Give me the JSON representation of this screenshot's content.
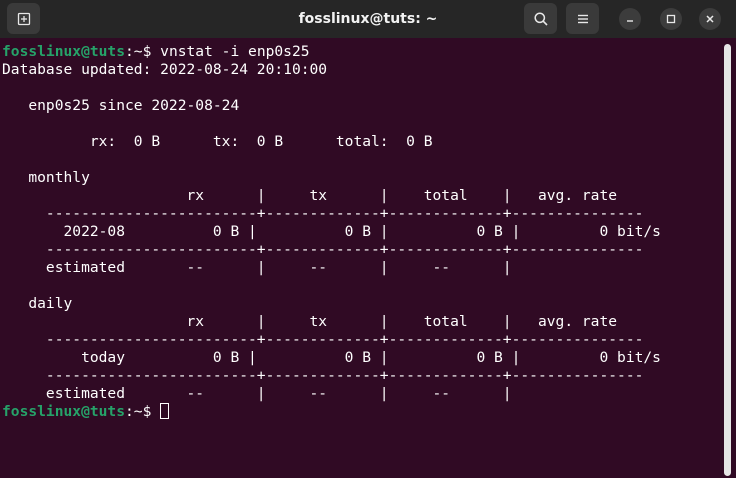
{
  "window": {
    "title": "fosslinux@tuts: ~"
  },
  "terminal": {
    "lines": [
      {
        "type": "prompt",
        "user": "fosslinux@tuts",
        "path": ":~",
        "cmd": "$ vnstat -i enp0s25"
      },
      {
        "type": "text",
        "text": "Database updated: 2022-08-24 20:10:00"
      },
      {
        "type": "text",
        "text": ""
      },
      {
        "type": "text",
        "text": "   enp0s25 since 2022-08-24"
      },
      {
        "type": "text",
        "text": ""
      },
      {
        "type": "text",
        "text": "          rx:  0 B      tx:  0 B      total:  0 B"
      },
      {
        "type": "text",
        "text": ""
      },
      {
        "type": "text",
        "text": "   monthly"
      },
      {
        "type": "text",
        "text": "                     rx      |     tx      |    total    |   avg. rate"
      },
      {
        "type": "text",
        "text": "     ------------------------+-------------+-------------+---------------"
      },
      {
        "type": "text",
        "text": "       2022-08          0 B |          0 B |          0 B |         0 bit/s"
      },
      {
        "type": "text",
        "text": "     ------------------------+-------------+-------------+---------------"
      },
      {
        "type": "text",
        "text": "     estimated       --      |     --      |     --      |"
      },
      {
        "type": "text",
        "text": ""
      },
      {
        "type": "text",
        "text": "   daily"
      },
      {
        "type": "text",
        "text": "                     rx      |     tx      |    total    |   avg. rate"
      },
      {
        "type": "text",
        "text": "     ------------------------+-------------+-------------+---------------"
      },
      {
        "type": "text",
        "text": "         today          0 B |          0 B |          0 B |         0 bit/s"
      },
      {
        "type": "text",
        "text": "     ------------------------+-------------+-------------+---------------"
      },
      {
        "type": "text",
        "text": "     estimated       --      |     --      |     --      |"
      },
      {
        "type": "prompt",
        "user": "fosslinux@tuts",
        "path": ":~",
        "cmd": "$ ",
        "cursor": true
      }
    ]
  },
  "icons": {
    "new_tab": "new-tab-icon",
    "search": "search-icon",
    "menu": "hamburger-menu-icon",
    "minimize": "minimize-icon",
    "maximize": "maximize-icon",
    "close": "close-icon"
  },
  "colors": {
    "background": "#300a24",
    "titlebar": "#262626",
    "prompt_user": "#26a269",
    "text": "#ffffff"
  }
}
